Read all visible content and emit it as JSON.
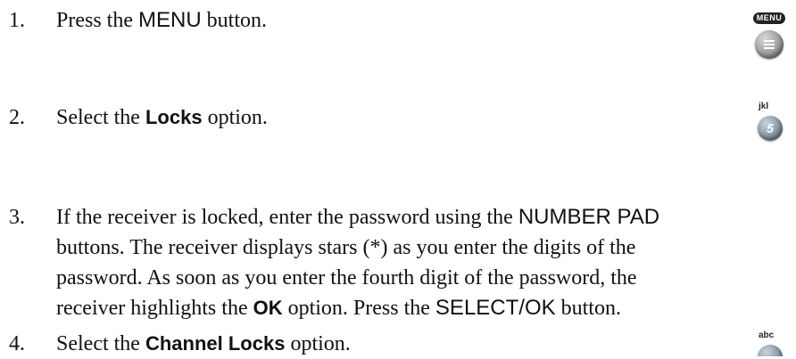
{
  "steps": [
    {
      "number": "1.",
      "parts": {
        "a": "Press the ",
        "b": "MENU",
        "c": " button."
      }
    },
    {
      "number": "2.",
      "parts": {
        "a": "Select the ",
        "b": "Locks",
        "c": " option."
      }
    },
    {
      "number": "3.",
      "lines": {
        "l1a": "If the receiver is locked, enter the password using the ",
        "l1b": "NUMBER PAD",
        "l2": "buttons. The receiver displays stars (*) as you enter the digits of the",
        "l3": "password. As soon as you enter the fourth digit of the password, the",
        "l4a": "receiver highlights the ",
        "l4b": "OK",
        "l4c": " option. Press the ",
        "l4d": "SELECT/OK",
        "l4e": " button."
      }
    },
    {
      "number": "4.",
      "parts": {
        "a": "Select the ",
        "b": "Channel Locks",
        "c": " option."
      }
    }
  ],
  "buttons": {
    "menu": {
      "label": "MENU",
      "icon": "menu-lines-icon"
    },
    "five": {
      "label": "jkl",
      "glyph": "5"
    },
    "two": {
      "label": "abc"
    }
  }
}
